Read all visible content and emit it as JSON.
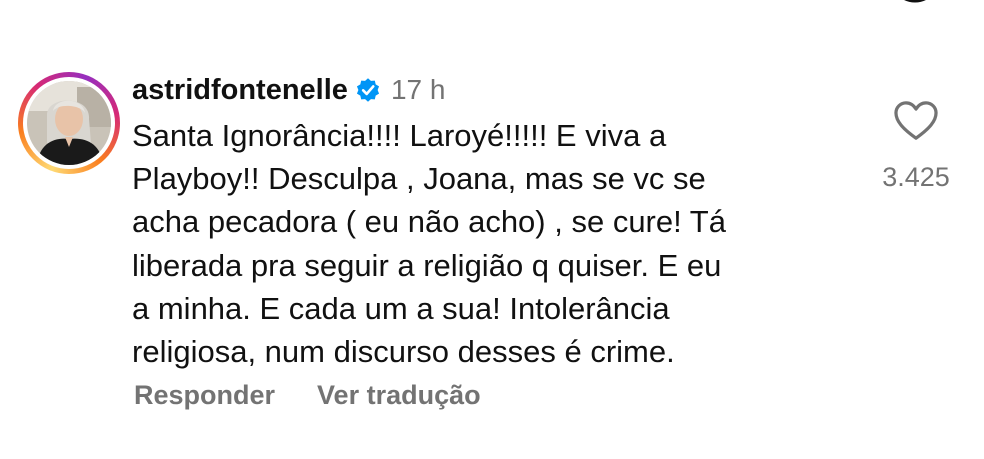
{
  "comment": {
    "username": "astridfontenelle",
    "verified": true,
    "timestamp": "17 h",
    "lines": [
      "Santa Ignorância!!!! Laroyé!!!!! E viva a",
      "Playboy!! Desculpa , Joana, mas se vc se",
      "acha pecadora ( eu não acho) , se cure! Tá",
      "liberada pra seguir a religião q quiser. E eu",
      "a minha. E cada um a sua! Intolerância",
      "religiosa, num discurso desses é crime."
    ],
    "like_count": "3.425"
  },
  "actions": {
    "reply_label": "Responder",
    "translate_label": "Ver tradução"
  },
  "icons": {
    "verified": "verified-badge-icon",
    "like": "heart-icon",
    "top_partial": "circle-icon"
  },
  "colors": {
    "verified_blue": "#0095f6",
    "secondary_text": "#737373",
    "primary_text": "#111111"
  }
}
